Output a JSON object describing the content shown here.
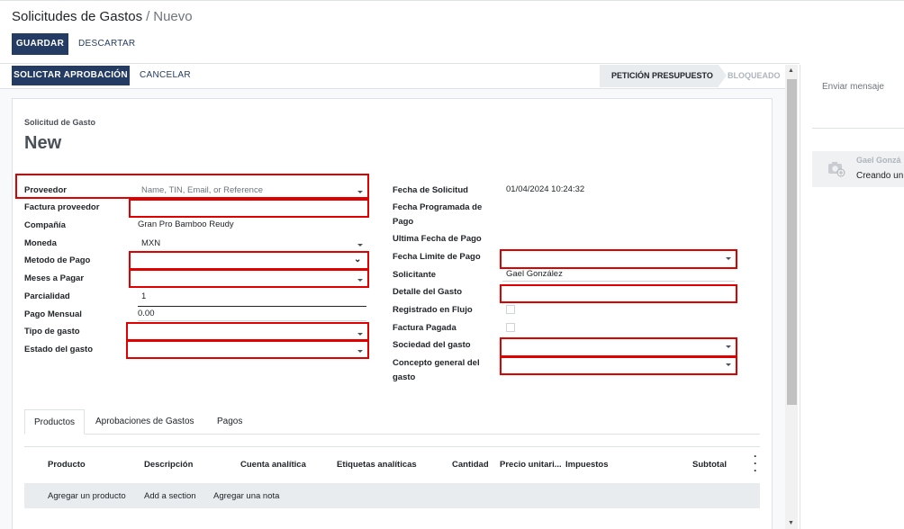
{
  "breadcrumb": {
    "parent": "Solicitudes de Gastos",
    "separator": "/",
    "current": "Nuevo"
  },
  "toolbar": {
    "save_label": "GUARDAR",
    "discard_label": "DESCARTAR"
  },
  "header": {
    "request_approval_label": "SOLICTAR APROBACIÓN",
    "cancel_label": "CANCELAR",
    "stages": [
      {
        "label": "PETICIÓN PRESUPUESTO",
        "active": true
      },
      {
        "label": "BLOQUEADO",
        "active": false
      }
    ]
  },
  "form": {
    "subtitle": "Solicitud de Gasto",
    "title": "New",
    "left": {
      "proveedor": {
        "label": "Proveedor",
        "placeholder": "Name, TIN, Email, or Reference"
      },
      "factura_proveedor": {
        "label": "Factura proveedor"
      },
      "compania": {
        "label": "Compañía",
        "value": "Gran Pro Bamboo Reudy"
      },
      "moneda": {
        "label": "Moneda",
        "value": "MXN"
      },
      "metodo_pago": {
        "label": "Metodo de Pago"
      },
      "meses_pagar": {
        "label": "Meses a Pagar"
      },
      "parcialidad": {
        "label": "Parcialidad",
        "value": "1"
      },
      "pago_mensual": {
        "label": "Pago Mensual",
        "value": "0.00"
      },
      "tipo_gasto": {
        "label": "Tipo de gasto"
      },
      "estado_gasto": {
        "label": "Estado del gasto"
      }
    },
    "right": {
      "fecha_solicitud": {
        "label": "Fecha de Solicitud",
        "value": "01/04/2024 10:24:32"
      },
      "fecha_programada": {
        "label_line1": "Fecha Programada de",
        "label_line2": "Pago"
      },
      "ultima_fecha": {
        "label": "Ultima Fecha de Pago"
      },
      "fecha_limite": {
        "label": "Fecha Limite de Pago"
      },
      "solicitante": {
        "label": "Solicitante",
        "value": "Gael González"
      },
      "detalle": {
        "label": "Detalle del Gasto"
      },
      "registrado_flujo": {
        "label": "Registrado en Flujo",
        "checked": false
      },
      "factura_pagada": {
        "label": "Factura Pagada",
        "checked": false
      },
      "sociedad": {
        "label": "Sociedad del gasto"
      },
      "concepto": {
        "label_line1": "Concepto general del",
        "label_line2": "gasto"
      }
    }
  },
  "tabs": [
    {
      "label": "Productos",
      "active": true
    },
    {
      "label": "Aprobaciones de Gastos",
      "active": false
    },
    {
      "label": "Pagos",
      "active": false
    }
  ],
  "lines_table": {
    "columns": [
      "Producto",
      "Descripción",
      "Cuenta analítica",
      "Etiquetas analíticas",
      "Cantidad",
      "Precio unitari...",
      "Impuestos",
      "Subtotal"
    ],
    "add_product": "Agregar un producto",
    "add_section": "Add a section",
    "add_note": "Agregar una nota"
  },
  "chatter": {
    "send_message": "Enviar mensaje",
    "author": "Gael Gonzá",
    "message": "Creando un"
  },
  "colors": {
    "primary": "#243b63",
    "highlight_box": "#e00000",
    "stage_active_bg": "#e9ecef"
  }
}
